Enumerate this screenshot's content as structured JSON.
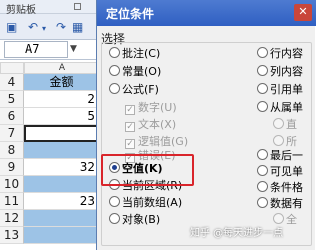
{
  "ribbon": {
    "clipboard_label": "剪贴板"
  },
  "name_box": {
    "value": "A7"
  },
  "sheet": {
    "column_header": "A",
    "rows": [
      {
        "num": "4",
        "value": "金额"
      },
      {
        "num": "5",
        "value": "2"
      },
      {
        "num": "6",
        "value": "5"
      },
      {
        "num": "7",
        "value": ""
      },
      {
        "num": "8",
        "value": ""
      },
      {
        "num": "9",
        "value": "32"
      },
      {
        "num": "10",
        "value": ""
      },
      {
        "num": "11",
        "value": "23"
      },
      {
        "num": "12",
        "value": ""
      },
      {
        "num": "13",
        "value": ""
      }
    ]
  },
  "dialog": {
    "title": "定位条件",
    "close_glyph": "✕",
    "section_label": "选择",
    "left_options": [
      "批注(C)",
      "常量(O)",
      "公式(F)",
      "数字(U)",
      "文本(X)",
      "逻辑值(G)",
      "错误(E)",
      "空值(K)",
      "当前区域(R)",
      "当前数组(A)",
      "对象(B)"
    ],
    "right_options": [
      "行内容",
      "列内容",
      "引用单",
      "从属单",
      "直",
      "所",
      "最后一",
      "可见单",
      "条件格",
      "数据有",
      "全"
    ],
    "selected": "空值(K)"
  },
  "watermark": "知乎 @每天进步一点"
}
